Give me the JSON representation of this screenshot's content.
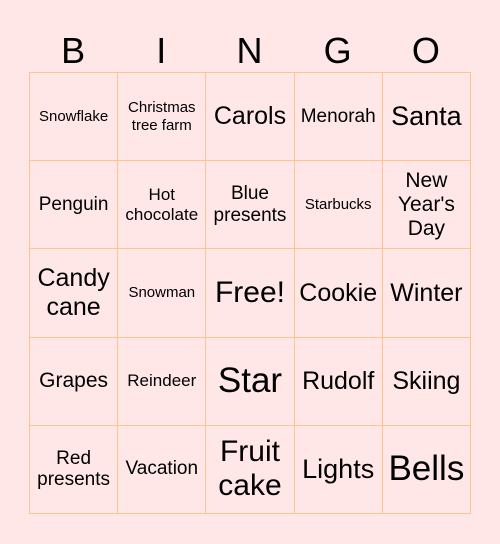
{
  "header": {
    "letters": [
      "B",
      "I",
      "N",
      "G",
      "O"
    ]
  },
  "colors": {
    "background": "#ffe7e7",
    "border": "#fdc48c"
  },
  "board": {
    "rows": [
      [
        "Snowflake",
        "Christmas tree farm",
        "Carols",
        "Menorah",
        "Santa"
      ],
      [
        "Penguin",
        "Hot chocolate",
        "Blue presents",
        "Starbucks",
        "New Year's Day"
      ],
      [
        "Candy cane",
        "Snowman",
        "Free!",
        "Cookie",
        "Winter"
      ],
      [
        "Grapes",
        "Reindeer",
        "Star",
        "Rudolf",
        "Skiing"
      ],
      [
        "Red presents",
        "Vacation",
        "Fruit cake",
        "Lights",
        "Bells"
      ]
    ]
  }
}
